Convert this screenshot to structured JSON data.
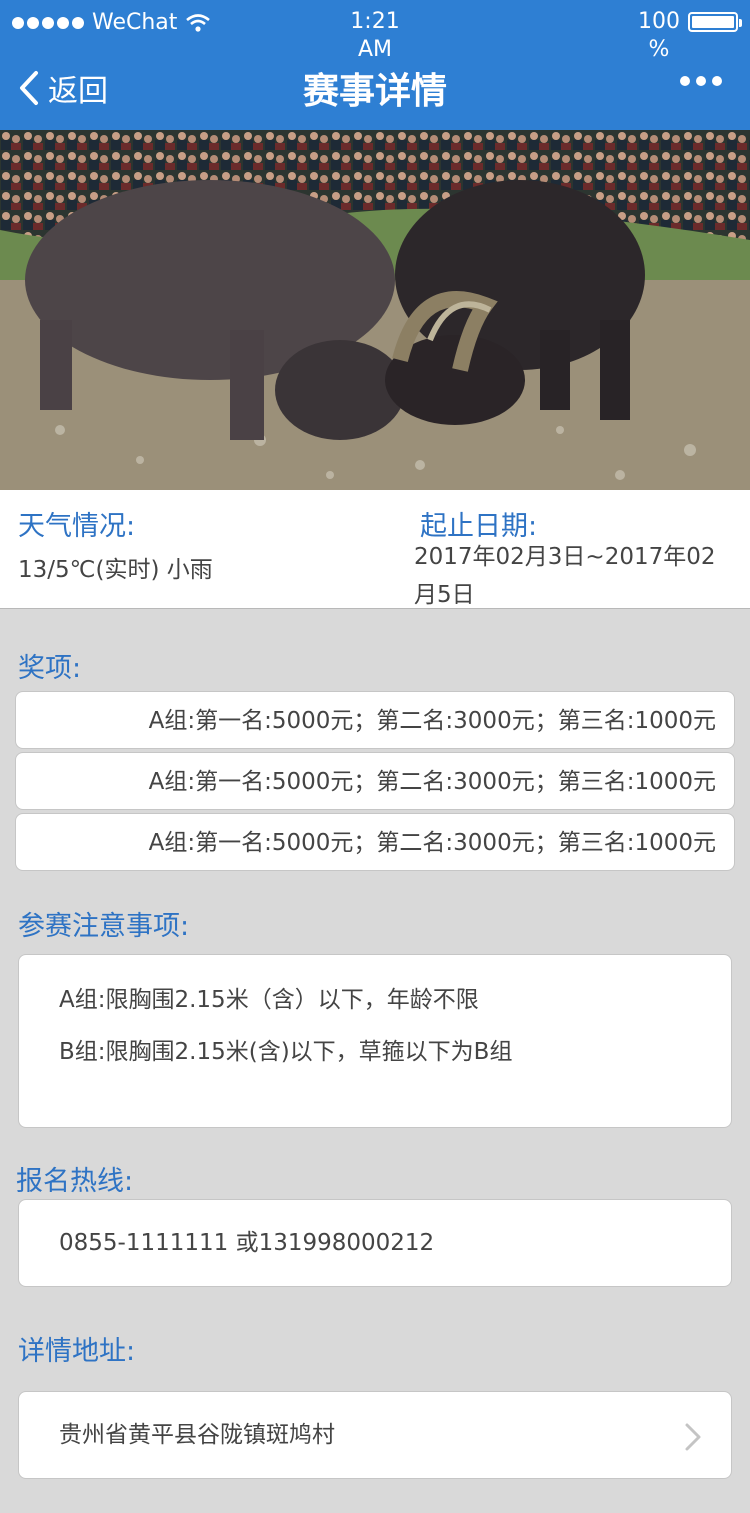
{
  "status_bar": {
    "carrier": "WeChat",
    "time_line1": "1:21",
    "time_line2": "AM",
    "battery_line1": "100",
    "battery_line2": "%"
  },
  "nav": {
    "back_label": "返回",
    "title": "赛事详情"
  },
  "hero": {
    "icon": "bullfight-photo"
  },
  "info": {
    "weather_label": "天气情况:",
    "weather_value": "13/5℃(实时) 小雨",
    "date_label": "起止日期:",
    "date_value": "2017年02月3日~2017年02月5日"
  },
  "prizes": {
    "label": "奖项:",
    "items": [
      "A组:第一名:5000元；第二名:3000元；第三名:1000元",
      "A组:第一名:5000元；第二名:3000元；第三名:1000元",
      "A组:第一名:5000元；第二名:3000元；第三名:1000元"
    ]
  },
  "notes": {
    "label": "参赛注意事项:",
    "lines": [
      "A组:限胸围2.15米（含）以下，年龄不限",
      "B组:限胸围2.15米(含)以下，草箍以下为B组"
    ]
  },
  "hotline": {
    "label": "报名热线:",
    "value": "0855-1111111 或131998000212"
  },
  "address": {
    "label": "详情地址:",
    "value": "贵州省黄平县谷陇镇斑鸠村"
  },
  "colors": {
    "header_bg": "#2e7fd3",
    "accent_text": "#2e73c4",
    "page_bg": "#d9d9d9"
  }
}
